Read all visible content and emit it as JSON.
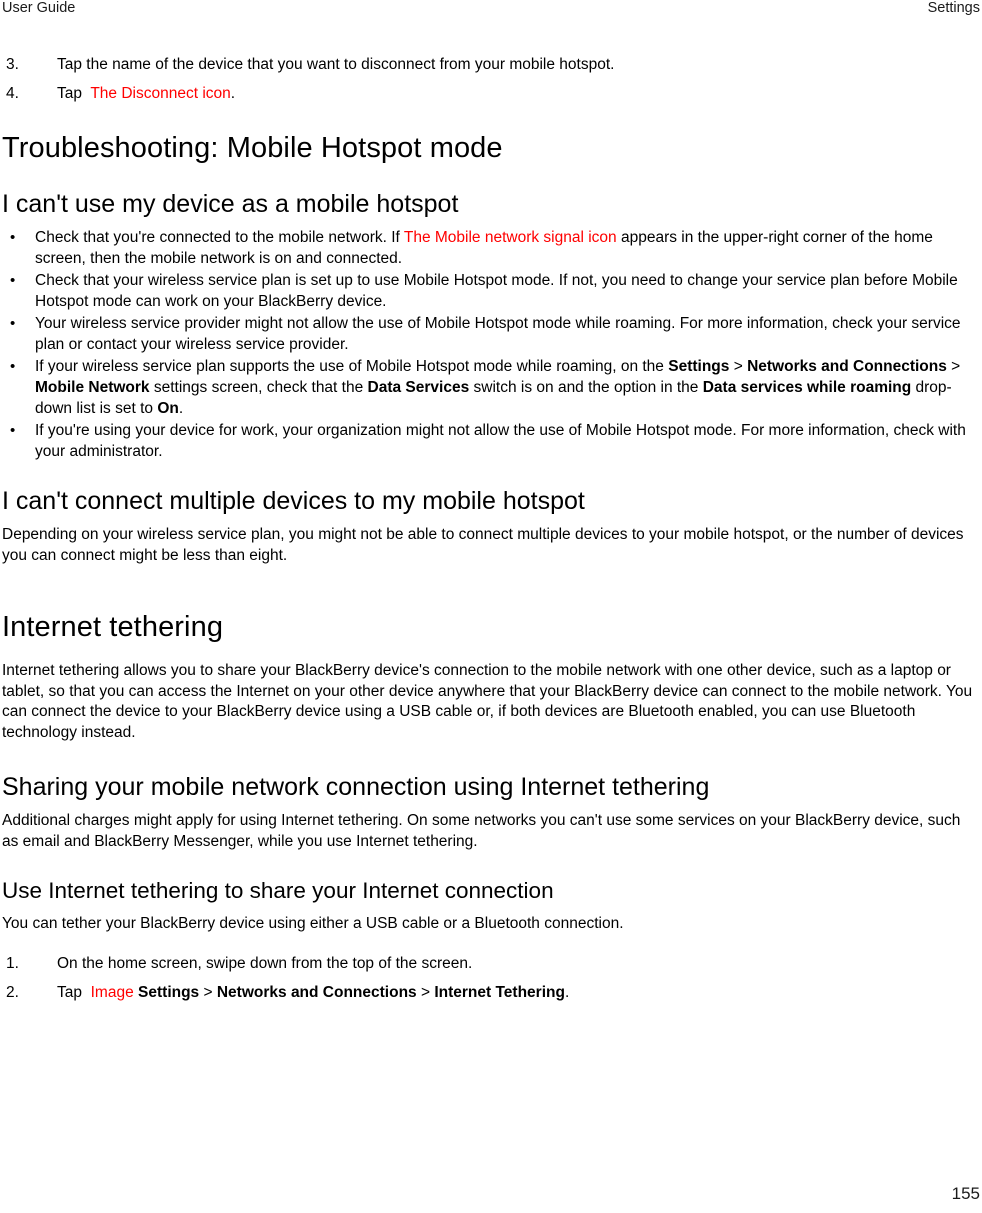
{
  "header": {
    "left": "User Guide",
    "right": "Settings"
  },
  "steps_disconnect": [
    {
      "num": "3.",
      "text": "Tap the name of the device that you want to disconnect from your mobile hotspot."
    },
    {
      "num": "4.",
      "pre": "Tap",
      "link": "The Disconnect icon",
      "post": "."
    }
  ],
  "chapter_troubleshooting": "Troubleshooting: Mobile Hotspot mode",
  "section_cannot_use": "I can't use my device as a mobile hotspot",
  "bullets_cannot_use": [
    {
      "marker": "•",
      "parts": [
        {
          "type": "text",
          "value": "Check that you're connected to the mobile network. If "
        },
        {
          "type": "red",
          "value": "The Mobile network signal icon"
        },
        {
          "type": "text",
          "value": "  appears in the upper-right corner of the home screen, then the mobile network is on and connected."
        }
      ]
    },
    {
      "marker": "•",
      "parts": [
        {
          "type": "text",
          "value": "Check that your wireless service plan is set up to use Mobile Hotspot mode. If not, you need to change your service plan before Mobile Hotspot mode can work on your BlackBerry device."
        }
      ]
    },
    {
      "marker": "•",
      "parts": [
        {
          "type": "text",
          "value": "Your wireless service provider might not allow the use of Mobile Hotspot mode while roaming. For more information, check your service plan or contact your wireless service provider."
        }
      ]
    },
    {
      "marker": "•",
      "parts": [
        {
          "type": "text",
          "value": "If your wireless service plan supports the use of Mobile Hotspot mode while roaming, on the "
        },
        {
          "type": "bold",
          "value": "Settings"
        },
        {
          "type": "text",
          "value": " > "
        },
        {
          "type": "bold",
          "value": "Networks and Connections"
        },
        {
          "type": "text",
          "value": " > "
        },
        {
          "type": "bold",
          "value": "Mobile Network"
        },
        {
          "type": "text",
          "value": " settings screen, check that the "
        },
        {
          "type": "bold",
          "value": "Data Services"
        },
        {
          "type": "text",
          "value": " switch is on and the option in the "
        },
        {
          "type": "bold",
          "value": "Data services while roaming"
        },
        {
          "type": "text",
          "value": " drop-down list is set to "
        },
        {
          "type": "bold",
          "value": "On"
        },
        {
          "type": "text",
          "value": "."
        }
      ]
    },
    {
      "marker": "•",
      "parts": [
        {
          "type": "text",
          "value": "If you're using your device for work, your organization might not allow the use of Mobile Hotspot mode. For more information, check with your administrator."
        }
      ]
    }
  ],
  "section_cannot_connect_multiple": "I can't connect multiple devices to my mobile hotspot",
  "para_multiple": "Depending on your wireless service plan, you might not be able to connect multiple devices to your mobile hotspot, or the number of devices you can connect might be less than eight.",
  "chapter_internet_tethering": "Internet tethering",
  "para_internet_tethering": "Internet tethering allows you to share your BlackBerry device's connection to the mobile network with one other device, such as a laptop or tablet, so that you can access the Internet on your other device anywhere that your BlackBerry device can connect to the mobile network. You can connect the device to your BlackBerry device using a USB cable or, if both devices are Bluetooth enabled, you can use Bluetooth technology instead.",
  "section_sharing": "Sharing your mobile network connection using Internet tethering",
  "para_sharing": "Additional charges might apply for using Internet tethering. On some networks you can't use some services on your BlackBerry device, such as email and BlackBerry Messenger, while you use Internet tethering.",
  "section_use_tethering": "Use Internet tethering to share your Internet connection",
  "para_use_tethering": "You can tether your BlackBerry device using either a USB cable or a Bluetooth connection.",
  "steps_tethering": [
    {
      "num": "1.",
      "text": "On the home screen, swipe down from the top of the screen."
    },
    {
      "num": "2.",
      "pre": "Tap",
      "link": "Image",
      "trail": [
        {
          "type": "bold",
          "value": "Settings"
        },
        {
          "type": "text",
          "value": " > "
        },
        {
          "type": "bold",
          "value": "Networks and Connections"
        },
        {
          "type": "text",
          "value": " > "
        },
        {
          "type": "bold",
          "value": "Internet Tethering"
        },
        {
          "type": "text",
          "value": "."
        }
      ]
    }
  ],
  "folio": "155",
  "colors": {
    "link_red": "#ff0000",
    "text": "#000000",
    "background": "#ffffff"
  }
}
